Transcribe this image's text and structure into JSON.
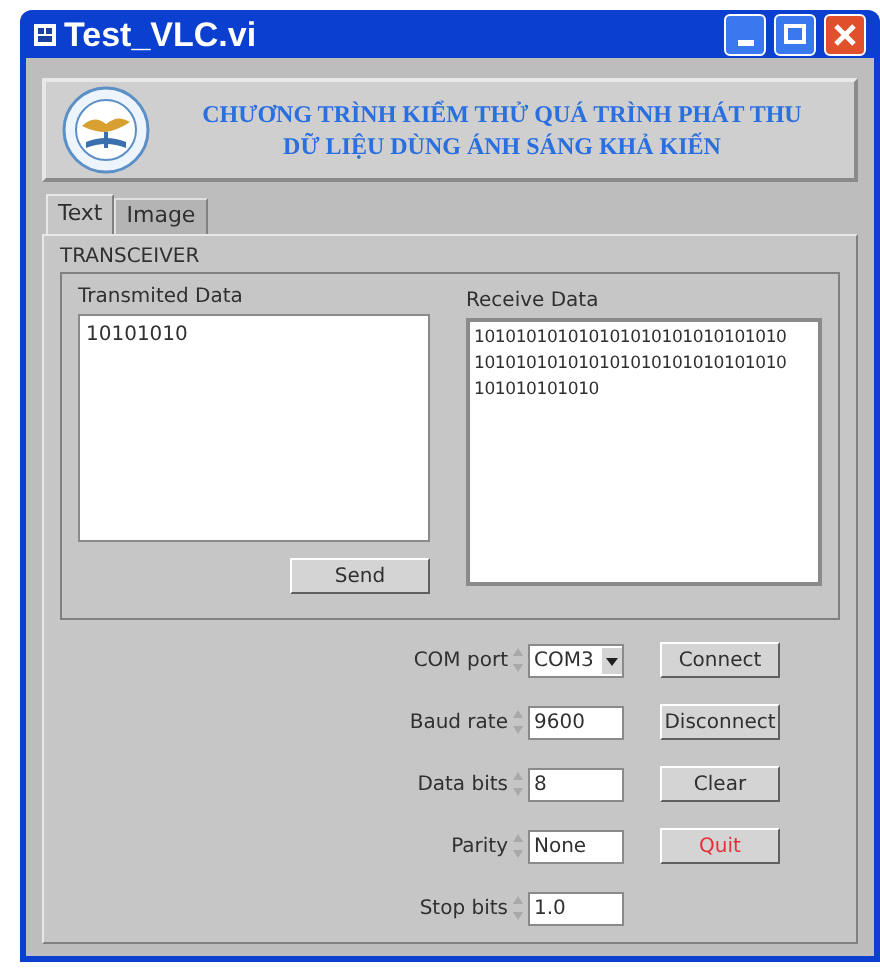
{
  "window": {
    "title": "Test_VLC.vi"
  },
  "banner": {
    "lines": [
      "CHƯƠNG TRÌNH KIỂM THỬ QUÁ TRÌNH PHÁT THU",
      "DỮ LIỆU DÙNG ÁNH SÁNG KHẢ KIẾN"
    ]
  },
  "tabs": [
    {
      "label": "Text",
      "selected": true
    },
    {
      "label": "Image",
      "selected": false
    }
  ],
  "transceiver": {
    "title": "TRANSCEIVER",
    "transmit_label": "Transmited Data",
    "transmit_value": "10101010",
    "send": "Send",
    "receive_label": "Receive Data",
    "receive_lines": [
      "101010101010101010101010101010",
      "101010101010101010101010101010",
      "101010101010"
    ]
  },
  "settings": [
    {
      "label": "COM port",
      "kind": "dropdown",
      "value": "COM3"
    },
    {
      "label": "Baud rate",
      "kind": "numeric",
      "value": "9600"
    },
    {
      "label": "Data bits",
      "kind": "numeric",
      "value": "8"
    },
    {
      "label": "Parity",
      "kind": "numeric",
      "value": "None"
    },
    {
      "label": "Stop bits",
      "kind": "numeric",
      "value": "1.0"
    }
  ],
  "buttons": [
    {
      "label": "Connect",
      "color": "#303030"
    },
    {
      "label": "Disconnect",
      "color": "#303030"
    },
    {
      "label": "Clear",
      "color": "#303030"
    },
    {
      "label": "Quit",
      "color": "#e8303a"
    }
  ]
}
